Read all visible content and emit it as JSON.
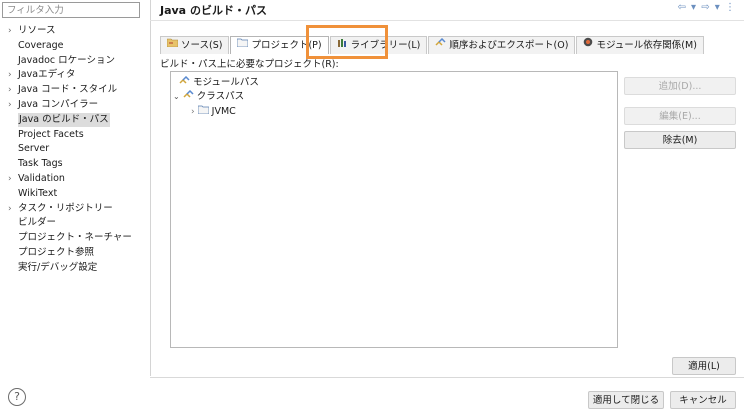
{
  "sidebar": {
    "filter_placeholder": "フィルタ入力",
    "items": [
      {
        "label": "リソース",
        "expandable": true
      },
      {
        "label": "Coverage",
        "expandable": false
      },
      {
        "label": "Javadoc ロケーション",
        "expandable": false
      },
      {
        "label": "Javaエディタ",
        "expandable": true
      },
      {
        "label": "Java コード・スタイル",
        "expandable": true
      },
      {
        "label": "Java コンパイラー",
        "expandable": true
      },
      {
        "label": "Java のビルド・パス",
        "expandable": false,
        "selected": true
      },
      {
        "label": "Project Facets",
        "expandable": false
      },
      {
        "label": "Server",
        "expandable": false
      },
      {
        "label": "Task Tags",
        "expandable": false
      },
      {
        "label": "Validation",
        "expandable": true
      },
      {
        "label": "WikiText",
        "expandable": false
      },
      {
        "label": "タスク・リポジトリー",
        "expandable": true
      },
      {
        "label": "ビルダー",
        "expandable": false
      },
      {
        "label": "プロジェクト・ネーチャー",
        "expandable": false
      },
      {
        "label": "プロジェクト参照",
        "expandable": false
      },
      {
        "label": "実行/デバッグ設定",
        "expandable": false
      }
    ]
  },
  "header": {
    "title": "Java のビルド・パス",
    "nav_arrows": "⇦ ▾ ⇨ ▾ ⋮"
  },
  "tabs": [
    {
      "label": "ソース(S)",
      "icon": "source-folder-icon"
    },
    {
      "label": "プロジェクト(P)",
      "icon": "project-icon",
      "active": true
    },
    {
      "label": "ライブラリー(L)",
      "icon": "library-icon"
    },
    {
      "label": "順序およびエクスポート(O)",
      "icon": "order-export-icon"
    },
    {
      "label": "モジュール依存関係(M)",
      "icon": "module-dependency-icon"
    }
  ],
  "content": {
    "required_label": "ビルド・パス上に必要なプロジェクト(R):",
    "tree": [
      {
        "label": "モジュールパス",
        "icon": "module-path-icon",
        "indent": 0
      },
      {
        "label": "クラスパス",
        "icon": "class-path-icon",
        "indent": 0,
        "expanded": true
      },
      {
        "label": "JVMC",
        "icon": "project-folder-icon",
        "indent": 1
      }
    ],
    "buttons": {
      "add": "追加(D)...",
      "edit": "編集(E)...",
      "remove": "除去(M)"
    },
    "apply": "適用(L)"
  },
  "footer": {
    "help": "?",
    "apply_close": "適用して閉じる",
    "cancel": "キャンセル"
  },
  "colors": {
    "highlight": "#f0913a"
  }
}
